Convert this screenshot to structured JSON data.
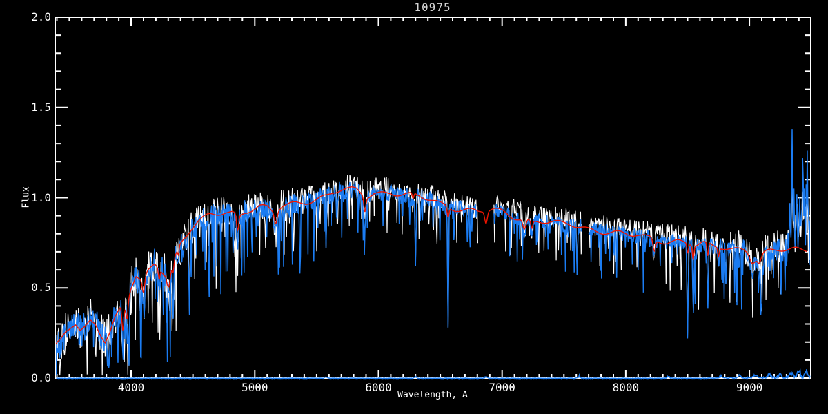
{
  "title": "10975",
  "chart_data": {
    "type": "line",
    "title": "10975",
    "xlabel": "Wavelength, A",
    "ylabel": "Flux",
    "xlim": [
      3386,
      9496
    ],
    "ylim": [
      0,
      2
    ],
    "grid": false,
    "legend": "none",
    "background_color": "#000000",
    "axis_color": "#FFFFFF",
    "title_color": "#D4D4D4",
    "x_ticks": [
      {
        "value": 4000,
        "label": "4000"
      },
      {
        "value": 5000,
        "label": "5000"
      },
      {
        "value": 6000,
        "label": "6000"
      },
      {
        "value": 7000,
        "label": "7000"
      },
      {
        "value": 8000,
        "label": "8000"
      },
      {
        "value": 9000,
        "label": "9000"
      }
    ],
    "y_ticks": [
      {
        "value": 0.0,
        "label": "0.0"
      },
      {
        "value": 0.5,
        "label": "0.5"
      },
      {
        "value": 1.0,
        "label": "1.0"
      },
      {
        "value": 1.5,
        "label": "1.5"
      },
      {
        "value": 2.0,
        "label": "2.0"
      }
    ],
    "x_minor_step": 100,
    "y_minor_step": 0.1,
    "series": [
      {
        "name": "observed-spectrum-raw",
        "color": "#FFFFFF",
        "style": "noisy"
      },
      {
        "name": "observed-spectrum",
        "color": "#1B7CF2",
        "style": "noisy"
      },
      {
        "name": "model-fit",
        "color": "#F01400",
        "style": "smooth"
      },
      {
        "name": "noise-floor",
        "color": "#1B7CF2",
        "style": "flat near zero flux"
      }
    ],
    "continuum": [
      [
        3390,
        0.17
      ],
      [
        3430,
        0.2
      ],
      [
        3470,
        0.25
      ],
      [
        3510,
        0.28
      ],
      [
        3550,
        0.3
      ],
      [
        3590,
        0.26
      ],
      [
        3630,
        0.28
      ],
      [
        3670,
        0.32
      ],
      [
        3710,
        0.31
      ],
      [
        3750,
        0.26
      ],
      [
        3790,
        0.21
      ],
      [
        3830,
        0.26
      ],
      [
        3870,
        0.33
      ],
      [
        3910,
        0.38
      ],
      [
        3940,
        0.36
      ],
      [
        3970,
        0.42
      ],
      [
        4000,
        0.5
      ],
      [
        4040,
        0.56
      ],
      [
        4090,
        0.52
      ],
      [
        4140,
        0.59
      ],
      [
        4190,
        0.64
      ],
      [
        4240,
        0.61
      ],
      [
        4290,
        0.57
      ],
      [
        4340,
        0.64
      ],
      [
        4390,
        0.74
      ],
      [
        4440,
        0.79
      ],
      [
        4490,
        0.83
      ],
      [
        4540,
        0.86
      ],
      [
        4590,
        0.88
      ],
      [
        4640,
        0.9
      ],
      [
        4700,
        0.91
      ],
      [
        4760,
        0.92
      ],
      [
        4820,
        0.92
      ],
      [
        4870,
        0.9
      ],
      [
        4920,
        0.93
      ],
      [
        4980,
        0.94
      ],
      [
        5040,
        0.95
      ],
      [
        5100,
        0.94
      ],
      [
        5160,
        0.91
      ],
      [
        5220,
        0.95
      ],
      [
        5280,
        0.96
      ],
      [
        5340,
        0.97
      ],
      [
        5400,
        0.98
      ],
      [
        5460,
        0.99
      ],
      [
        5520,
        1.0
      ],
      [
        5580,
        1.01
      ],
      [
        5640,
        1.03
      ],
      [
        5700,
        1.04
      ],
      [
        5760,
        1.04
      ],
      [
        5820,
        1.04
      ],
      [
        5870,
        1.02
      ],
      [
        5910,
        1.01
      ],
      [
        5960,
        1.03
      ],
      [
        6020,
        1.03
      ],
      [
        6100,
        1.03
      ],
      [
        6180,
        1.02
      ],
      [
        6260,
        1.01
      ],
      [
        6340,
        1.0
      ],
      [
        6420,
        0.99
      ],
      [
        6500,
        0.97
      ],
      [
        6580,
        0.95
      ],
      [
        6660,
        0.94
      ],
      [
        6740,
        0.93
      ],
      [
        6807,
        0.92
      ],
      [
        6930,
        0.93
      ],
      [
        7000,
        0.92
      ],
      [
        7080,
        0.9
      ],
      [
        7160,
        0.89
      ],
      [
        7240,
        0.87
      ],
      [
        7320,
        0.87
      ],
      [
        7400,
        0.86
      ],
      [
        7480,
        0.85
      ],
      [
        7560,
        0.85
      ],
      [
        7645,
        0.84
      ],
      [
        7698,
        0.83
      ],
      [
        7780,
        0.82
      ],
      [
        7860,
        0.81
      ],
      [
        7940,
        0.8
      ],
      [
        8020,
        0.79
      ],
      [
        8100,
        0.79
      ],
      [
        8180,
        0.78
      ],
      [
        8260,
        0.77
      ],
      [
        8340,
        0.76
      ],
      [
        8420,
        0.76
      ],
      [
        8500,
        0.75
      ],
      [
        8560,
        0.73
      ],
      [
        8620,
        0.74
      ],
      [
        8700,
        0.73
      ],
      [
        8780,
        0.73
      ],
      [
        8860,
        0.72
      ],
      [
        8940,
        0.72
      ],
      [
        9000,
        0.71
      ],
      [
        9050,
        0.67
      ],
      [
        9110,
        0.68
      ],
      [
        9170,
        0.7
      ],
      [
        9230,
        0.71
      ],
      [
        9300,
        0.71
      ],
      [
        9380,
        0.72
      ],
      [
        9460,
        0.72
      ],
      [
        9496,
        0.72
      ]
    ],
    "absorption_features": [
      [
        3933,
        0.2,
        7
      ],
      [
        3968,
        0.16,
        7
      ],
      [
        4101,
        0.14,
        9
      ],
      [
        4227,
        0.1,
        6
      ],
      [
        4305,
        0.14,
        12
      ],
      [
        4340,
        0.1,
        7
      ],
      [
        4383,
        0.08,
        6
      ],
      [
        4861,
        0.16,
        8
      ],
      [
        5170,
        0.11,
        10
      ],
      [
        5890,
        0.15,
        8
      ],
      [
        6280,
        0.06,
        6
      ],
      [
        6563,
        0.1,
        7
      ],
      [
        6870,
        0.12,
        10
      ],
      [
        7180,
        0.1,
        12
      ],
      [
        7240,
        0.08,
        8
      ],
      [
        8230,
        0.12,
        10
      ],
      [
        8500,
        0.1,
        6
      ],
      [
        8545,
        0.14,
        6
      ],
      [
        8662,
        0.14,
        6
      ],
      [
        8750,
        0.08,
        6
      ],
      [
        9020,
        0.08,
        20
      ],
      [
        9080,
        0.08,
        15
      ]
    ],
    "deep_absorption_spikes": [
      [
        3985,
        0.07
      ],
      [
        4340,
        0.33
      ],
      [
        4471,
        0.35
      ],
      [
        5578,
        0.72
      ],
      [
        6301,
        0.62
      ],
      [
        6563,
        0.28
      ],
      [
        6870,
        0.56
      ],
      [
        7608,
        0.57
      ],
      [
        8500,
        0.22
      ],
      [
        8547,
        0.36
      ],
      [
        8662,
        0.45
      ],
      [
        8810,
        0.52
      ],
      [
        9025,
        0.55
      ]
    ],
    "emission_spikes": [
      [
        9329,
        0.97
      ],
      [
        9346,
        1.38
      ],
      [
        9362,
        1.05
      ],
      [
        9385,
        1.02
      ],
      [
        9405,
        1.0
      ],
      [
        9429,
        1.22
      ],
      [
        9446,
        1.05
      ],
      [
        9469,
        1.26
      ]
    ],
    "gaps": [
      [
        6807,
        6930
      ],
      [
        7645,
        7698
      ]
    ],
    "noise_profile": [
      [
        3386,
        0.085
      ],
      [
        3800,
        0.09
      ],
      [
        4200,
        0.08
      ],
      [
        4800,
        0.065
      ],
      [
        5400,
        0.055
      ],
      [
        6000,
        0.05
      ],
      [
        6600,
        0.045
      ],
      [
        7200,
        0.045
      ],
      [
        7900,
        0.04
      ],
      [
        8600,
        0.045
      ],
      [
        9000,
        0.05
      ],
      [
        9250,
        0.06
      ],
      [
        9400,
        0.1
      ],
      [
        9496,
        0.13
      ]
    ],
    "forest_profile": [
      [
        3386,
        0.4
      ],
      [
        3900,
        1.2
      ],
      [
        4200,
        1.6
      ],
      [
        4700,
        1.5
      ],
      [
        5200,
        1.3
      ],
      [
        5700,
        1.0
      ],
      [
        6200,
        0.85
      ],
      [
        6700,
        0.8
      ],
      [
        7100,
        1.0
      ],
      [
        7600,
        0.95
      ],
      [
        8100,
        1.0
      ],
      [
        8600,
        1.15
      ],
      [
        9000,
        1.1
      ],
      [
        9496,
        0.7
      ]
    ],
    "floor_level": 0.005,
    "floor_bumps": [
      [
        5577,
        0.012
      ],
      [
        6300,
        0.01
      ],
      [
        6870,
        0.012
      ],
      [
        7620,
        0.018
      ],
      [
        8344,
        0.015
      ],
      [
        8770,
        0.018
      ],
      [
        8920,
        0.02
      ],
      [
        9050,
        0.025
      ],
      [
        9160,
        0.03
      ],
      [
        9250,
        0.03
      ],
      [
        9340,
        0.045
      ],
      [
        9400,
        0.05
      ],
      [
        9460,
        0.045
      ]
    ]
  }
}
